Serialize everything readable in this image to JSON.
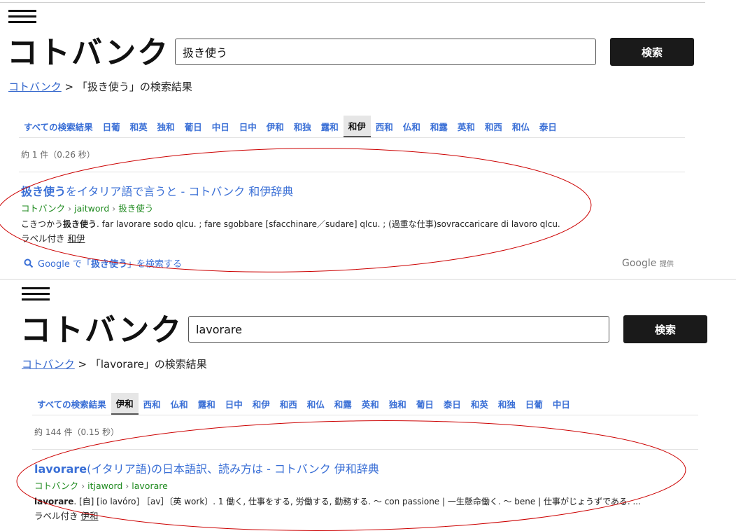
{
  "panels": [
    {
      "logo": "コトバンク",
      "search": {
        "value": "扱き使う",
        "button": "検索"
      },
      "breadcrumb": {
        "home": "コトバンク",
        "sep": " > ",
        "text": "「扱き使う」の検索結果"
      },
      "tabs": [
        "すべての検索結果",
        "日葡",
        "和英",
        "独和",
        "葡日",
        "中日",
        "日中",
        "伊和",
        "和独",
        "露和",
        "和伊",
        "西和",
        "仏和",
        "和露",
        "英和",
        "和西",
        "和仏",
        "泰日"
      ],
      "active_tab": "和伊",
      "count": "約 1 件（0.26 秒）",
      "result": {
        "title_bold": "扱き使う",
        "title_rest": "をイタリア語で言うと - コトバンク 和伊辞典",
        "url": [
          "コトバンク",
          "jaitword",
          "扱き使う"
        ],
        "snippet_pre": "こきつかう",
        "snippet_bold": "扱き使う",
        "snippet_post": ". far lavorare sodo qlcu. ;  fare sgobbare [sfacchinare／sudare] qlcu. ; (過重な仕事)sovraccaricare di lavoro qlcu.",
        "label_prefix": "ラベル付き",
        "label_link": "和伊"
      },
      "google_search": {
        "pre": "Google で「",
        "term": "扱き使う",
        "post": "」を検索する"
      },
      "google_credit": {
        "brand": "Google",
        "suffix": "提供"
      }
    },
    {
      "logo": "コトバンク",
      "search": {
        "value": "lavorare",
        "button": "検索"
      },
      "breadcrumb": {
        "home": "コトバンク",
        "sep": " > ",
        "text": "「lavorare」の検索結果"
      },
      "tabs": [
        "すべての検索結果",
        "伊和",
        "西和",
        "仏和",
        "露和",
        "日中",
        "和伊",
        "和西",
        "和仏",
        "和露",
        "英和",
        "独和",
        "葡日",
        "泰日",
        "和英",
        "和独",
        "日葡",
        "中日"
      ],
      "active_tab": "伊和",
      "count": "約 144 件（0.15 秒）",
      "result": {
        "title_bold": "lavorare",
        "title_rest": "(イタリア語)の日本語訳、読み方は - コトバンク 伊和辞典",
        "url": [
          "コトバンク",
          "itjaword",
          "lavorare"
        ],
        "snippet_bold": "lavorare",
        "snippet_post": ". [自] [io lavóro] ［av］〔英 work〕. 1 働く, 仕事をする, 労働する, 勤務する. ～ con passione | 一生懸命働く. ～ bene | 仕事がじょうずである. ...",
        "label_prefix": "ラベル付き",
        "label_link": "伊和"
      }
    }
  ],
  "colors": {
    "link": "#3a6fd6",
    "url_green": "#1e8a1e",
    "annotation": "#cc0000",
    "button_bg": "#1a1a1a"
  },
  "icons": {
    "search": "search-icon",
    "menu": "hamburger-icon"
  }
}
